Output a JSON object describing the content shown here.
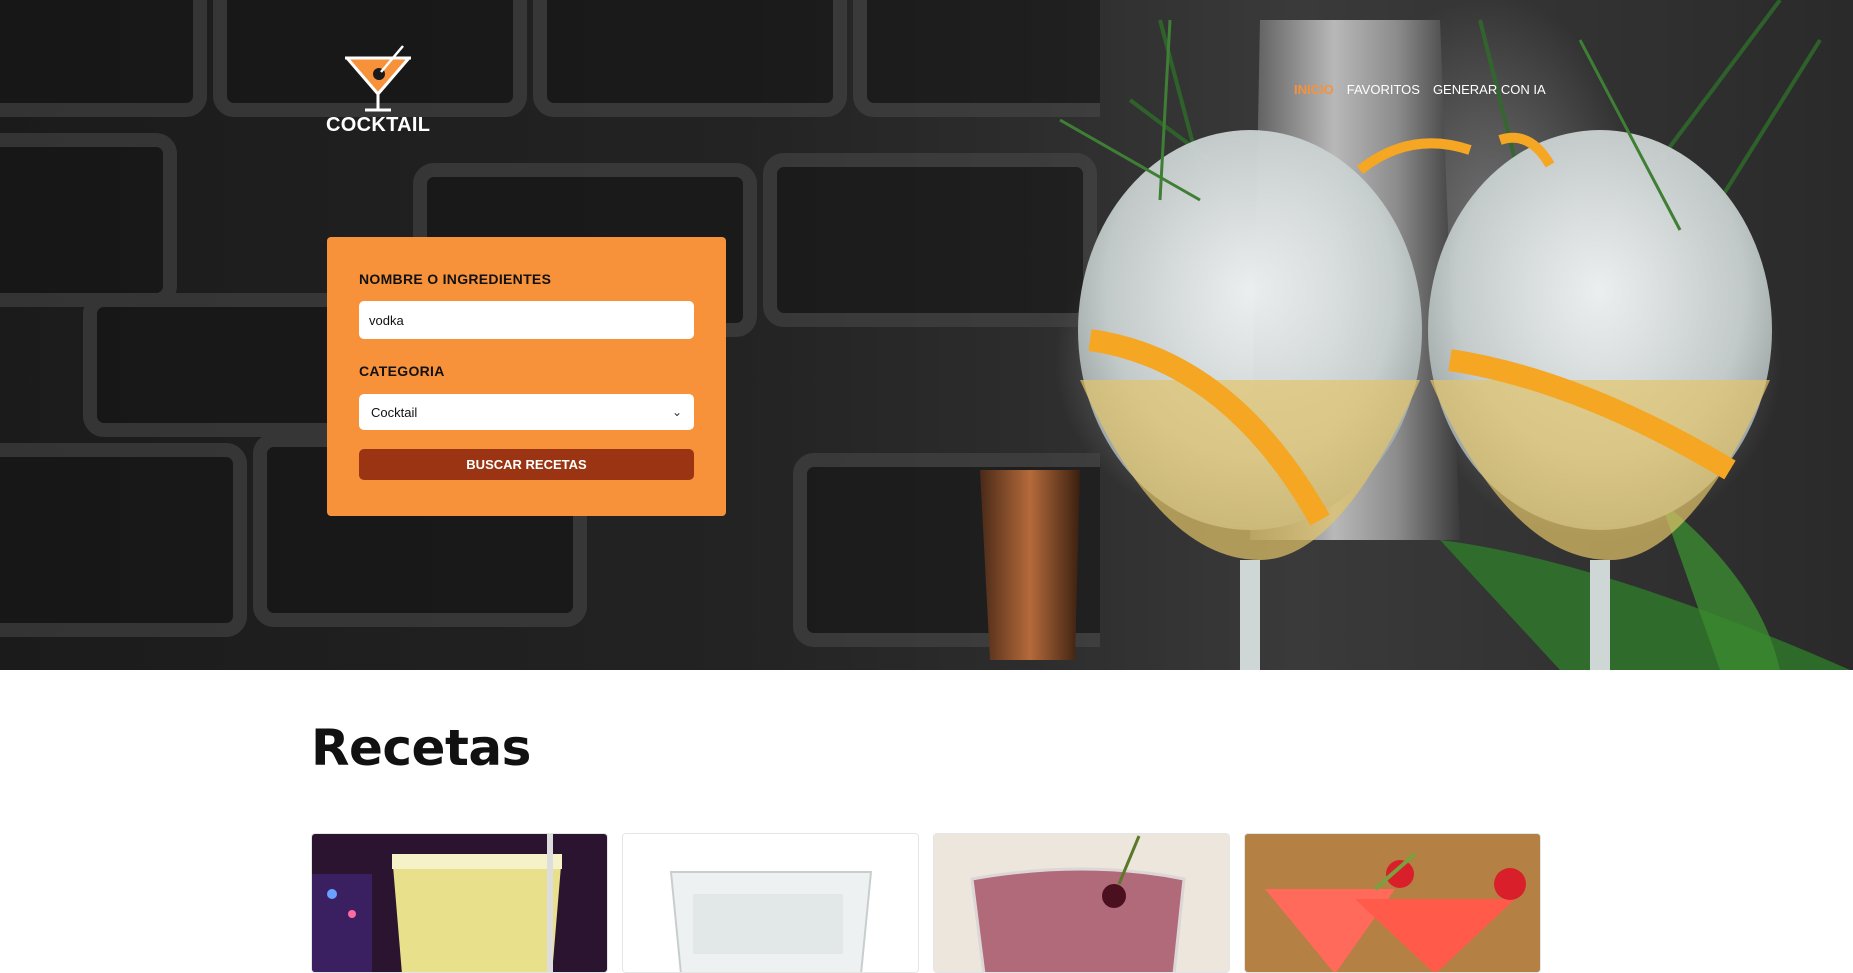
{
  "brand": {
    "name": "COCKTAIL",
    "accent": "#f7923a",
    "dark_accent": "#9a3412"
  },
  "nav": {
    "items": [
      {
        "label": "INICIO",
        "active": true
      },
      {
        "label": "FAVORITOS",
        "active": false
      },
      {
        "label": "GENERAR CON IA",
        "active": false
      }
    ]
  },
  "search": {
    "name_label": "NOMBRE O INGREDIENTES",
    "name_value": "vodka",
    "category_label": "CATEGORIA",
    "category_value": "Cocktail",
    "submit_label": "BUSCAR RECETAS"
  },
  "recipes": {
    "title": "Recetas",
    "cards": [
      {
        "image_icon": "yellow-drink-photo"
      },
      {
        "image_icon": "clear-drink-photo"
      },
      {
        "image_icon": "red-drink-photo"
      },
      {
        "image_icon": "strawberry-martini-photo"
      }
    ]
  }
}
